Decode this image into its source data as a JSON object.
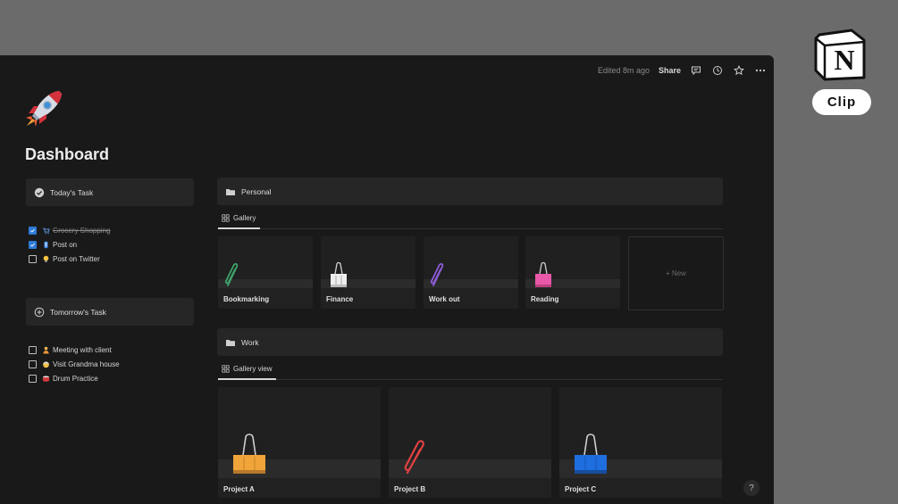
{
  "topbar": {
    "edited": "Edited 8m ago",
    "share": "Share",
    "icons": [
      "comment-icon",
      "clock-icon",
      "star-icon",
      "more-icon"
    ]
  },
  "page": {
    "icon": "rocket-icon",
    "title": "Dashboard"
  },
  "today": {
    "heading": "Today's Task",
    "items": [
      {
        "label": "Grocery Shopping",
        "checked": true,
        "emoji": "cart"
      },
      {
        "label": "Post on",
        "checked": true,
        "emoji": "phone"
      },
      {
        "label": "Post on Twitter",
        "checked": false,
        "emoji": "bulb"
      }
    ]
  },
  "tomorrow": {
    "heading": "Tomorrow's Task",
    "items": [
      {
        "label": "Meeting with client",
        "checked": false,
        "emoji": "person"
      },
      {
        "label": "Visit Grandma house",
        "checked": false,
        "emoji": "face"
      },
      {
        "label": "Drum Practice",
        "checked": false,
        "emoji": "drum"
      }
    ]
  },
  "personal": {
    "heading": "Personal",
    "tab": "Gallery",
    "cards": [
      "Bookmarking",
      "Finance",
      "Work out",
      "Reading"
    ],
    "new_label": "+ New"
  },
  "work": {
    "heading": "Work",
    "tab": "Gallery view",
    "cards": [
      "Project A",
      "Project B",
      "Project C"
    ]
  },
  "help": "?",
  "brand": {
    "logo_letter": "N",
    "clip_label": "Clip"
  },
  "colors": {
    "window_bg": "#191919",
    "card_bg": "#262626",
    "checkbox_blue": "#2d7bd6",
    "backdrop": "#6b6b6b"
  }
}
